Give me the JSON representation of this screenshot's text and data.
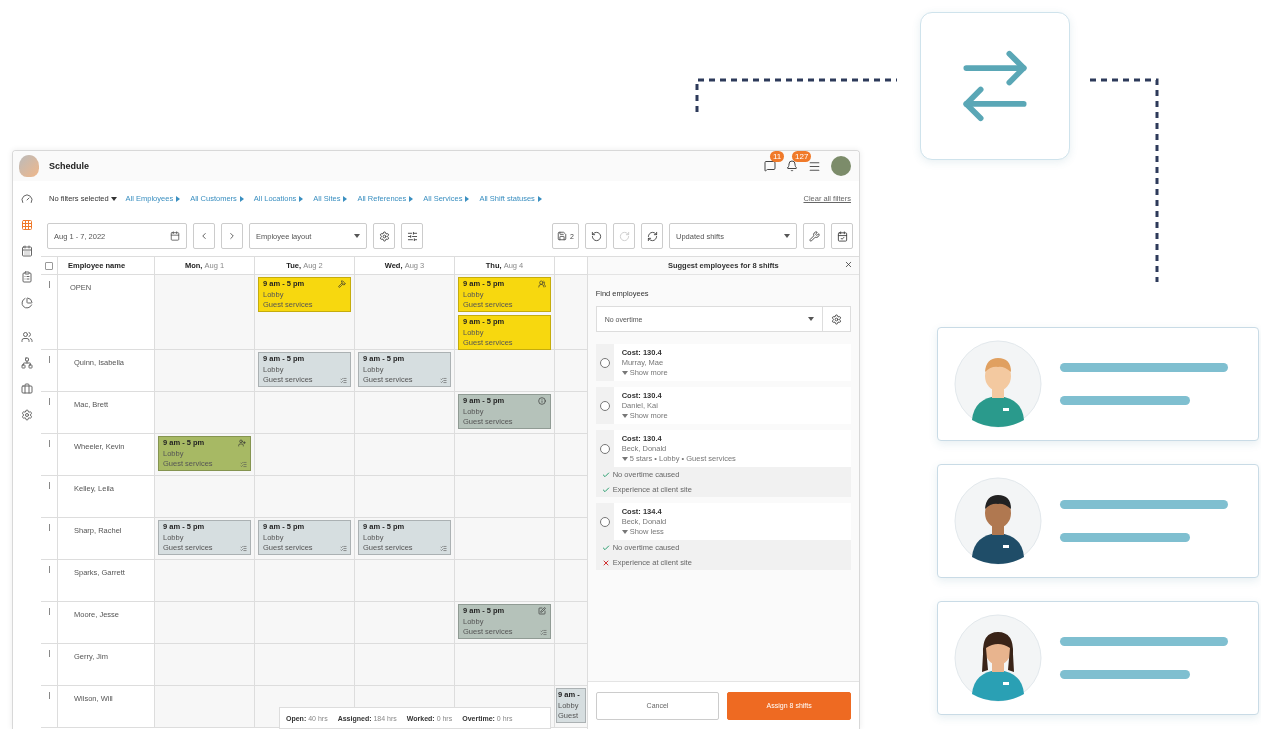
{
  "app": {
    "title": "Schedule",
    "badges": [
      {
        "count": "11"
      },
      {
        "count": "127"
      }
    ]
  },
  "sidebar": {
    "items": [
      {
        "kind": "dashboard",
        "selected": false
      },
      {
        "kind": "grid",
        "selected": true
      },
      {
        "kind": "calendar",
        "selected": false
      },
      {
        "kind": "clipboard",
        "selected": false
      },
      {
        "kind": "pie",
        "selected": false
      },
      {
        "kind": "people",
        "selected": false
      },
      {
        "kind": "org",
        "selected": false
      },
      {
        "kind": "briefcase",
        "selected": false
      },
      {
        "kind": "settings",
        "selected": false
      }
    ]
  },
  "filters": {
    "summary": "No filters selected",
    "items": [
      "All Employees",
      "All Customers",
      "All Locations",
      "All Sites",
      "All References",
      "All Services",
      "All Shift statuses"
    ],
    "clear": "Clear all filters"
  },
  "toolbar": {
    "date_range": "Aug 1 - 7, 2022",
    "layout": "Employee layout",
    "save_count": "2",
    "view": "Updated shifts"
  },
  "grid": {
    "select_all": {
      "checked": false
    },
    "columns": [
      {
        "day": "Mon,",
        "date": "Aug 1"
      },
      {
        "day": "Tue,",
        "date": "Aug 2"
      },
      {
        "day": "Wed,",
        "date": "Aug 3"
      },
      {
        "day": "Thu,",
        "date": "Aug 4"
      }
    ],
    "name_header": "Employee name",
    "rows": [
      {
        "name": "OPEN",
        "kind": "open",
        "cells": [
          null,
          [
            {
              "kind": "open_tool",
              "time": "9 am - 5 pm",
              "location": "Lobby",
              "service": "Guest services"
            }
          ],
          null,
          [
            {
              "kind": "open_group",
              "time": "9 am - 5 pm",
              "location": "Lobby",
              "service": "Guest services"
            },
            {
              "kind": "open",
              "time": "9 am - 5 pm",
              "location": "Lobby",
              "service": "Guest services"
            }
          ],
          null
        ]
      },
      {
        "name": "Quinn, Isabella",
        "kind": "employee",
        "cells": [
          null,
          [
            {
              "kind": "scheduled",
              "time": "9 am - 5 pm",
              "location": "Lobby",
              "service": "Guest services"
            }
          ],
          [
            {
              "kind": "scheduled",
              "time": "9 am - 5 pm",
              "location": "Lobby",
              "service": "Guest services"
            }
          ],
          null,
          null
        ]
      },
      {
        "name": "Mac, Brett",
        "kind": "employee",
        "cells": [
          null,
          null,
          null,
          [
            {
              "kind": "attention_info",
              "time": "9 am - 5 pm",
              "location": "Lobby",
              "service": "Guest services"
            }
          ],
          null
        ]
      },
      {
        "name": "Wheeler, Kevin",
        "kind": "employee",
        "cells": [
          [
            {
              "kind": "trade_assign",
              "time": "9 am - 5 pm",
              "location": "Lobby",
              "service": "Guest services"
            }
          ],
          null,
          null,
          null,
          null
        ]
      },
      {
        "name": "Kelley, Leila",
        "kind": "employee",
        "cells": [
          null,
          null,
          null,
          null,
          null
        ]
      },
      {
        "name": "Sharp, Rachel",
        "kind": "employee",
        "cells": [
          [
            {
              "kind": "scheduled",
              "time": "9 am - 5 pm",
              "location": "Lobby",
              "service": "Guest services"
            }
          ],
          [
            {
              "kind": "scheduled",
              "time": "9 am - 5 pm",
              "location": "Lobby",
              "service": "Guest services"
            }
          ],
          [
            {
              "kind": "scheduled",
              "time": "9 am - 5 pm",
              "location": "Lobby",
              "service": "Guest services"
            }
          ],
          null,
          null
        ]
      },
      {
        "name": "Sparks, Garrett",
        "kind": "employee",
        "cells": [
          null,
          null,
          null,
          null,
          null
        ]
      },
      {
        "name": "Moore, Jesse",
        "kind": "employee",
        "cells": [
          null,
          null,
          null,
          [
            {
              "kind": "attention_edit",
              "time": "9 am - 5 pm",
              "location": "Lobby",
              "service": "Guest services"
            }
          ],
          null
        ]
      },
      {
        "name": "Gerry, Jim",
        "kind": "employee",
        "cells": [
          null,
          null,
          null,
          null,
          null
        ]
      },
      {
        "name": "Wilson, Will",
        "kind": "employee",
        "cells": [
          null,
          null,
          null,
          null,
          [
            {
              "kind": "scheduled",
              "time": "9 am -",
              "location": "Lobby",
              "service": "Guest"
            }
          ]
        ]
      }
    ],
    "totals": [
      {
        "label": "Open:",
        "value": "40 hrs"
      },
      {
        "label": "Assigned:",
        "value": "184 hrs"
      },
      {
        "label": "Worked:",
        "value": "0 hrs"
      },
      {
        "label": "Overtime:",
        "value": "0 hrs"
      }
    ]
  },
  "panel": {
    "title": "Suggest employees for 8 shifts",
    "section": "Find employees",
    "filter": "No overtime",
    "candidates": [
      {
        "cost": "Cost: 130.4",
        "name": "Murray, Mae",
        "toggle": "Show more",
        "selected": false
      },
      {
        "cost": "Cost: 130.4",
        "name": "Daniel, Kai",
        "toggle": "Show more",
        "selected": false
      },
      {
        "cost": "Cost: 130.4",
        "name": "Beck, Donald",
        "toggle": "5 stars • Lobby • Guest services",
        "selected": false,
        "checks": [
          {
            "text": "No overtime caused",
            "ok": true
          },
          {
            "text": "Experience at client site",
            "ok": true
          }
        ]
      },
      {
        "cost": "Cost: 134.4",
        "name": "Beck, Donald",
        "toggle": "Show less",
        "selected": false,
        "checks": [
          {
            "text": "No overtime caused",
            "ok": true
          },
          {
            "text": "Experience at client site",
            "ok": false
          }
        ]
      }
    ],
    "cancel": "Cancel",
    "confirm": "Assign 8 shifts"
  },
  "people": [
    {
      "kind": "light"
    },
    {
      "kind": "dark"
    },
    {
      "kind": "woman"
    }
  ]
}
